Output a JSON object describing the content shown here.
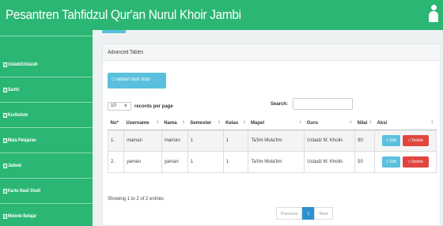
{
  "header": {
    "title": "Pesantren Tahfidzul Qur'an Nurul Khoir Jambi"
  },
  "sidebar": {
    "items": [
      {
        "label": "Ustadz/Ustazah"
      },
      {
        "label": "Santri"
      },
      {
        "label": "Kurikulum"
      },
      {
        "label": "Mata Pelajaran"
      },
      {
        "label": "Jadwal"
      },
      {
        "label": "Kartu Hasil Studi"
      },
      {
        "label": "Metode Belajar"
      }
    ]
  },
  "panel": {
    "heading": "Advanced Tables"
  },
  "toolbar": {
    "add_label": "□ Tambah Hasil Studi",
    "length_value": "10",
    "length_suffix": "records per page",
    "search_label": "Search:"
  },
  "table": {
    "columns": [
      "No*",
      "Username",
      "Nama",
      "Semester",
      "Kelas",
      "Mapel",
      "Guru",
      "Nilai",
      "Aksi"
    ],
    "rows": [
      {
        "no": "1.",
        "username": "maman",
        "nama": "maman",
        "semester": "1",
        "kelas": "1",
        "mapel": "Ta'lim Muta'lim",
        "guru": "Ustadz M. Kholis",
        "nilai": "90"
      },
      {
        "no": "2.",
        "username": "yaman",
        "nama": "yaman",
        "semester": "1",
        "kelas": "1",
        "mapel": "Ta'lim Muta'lim",
        "guru": "Ustadz M. Kholis",
        "nilai": "50"
      }
    ],
    "edit_label": "□ Edit",
    "delete_label": "□ Delete"
  },
  "footer": {
    "info": "Showing 1 to 2 of 2 entries",
    "prev": "Previous",
    "page": "1",
    "next": "Next"
  },
  "colors": {
    "brand": "#2bb673",
    "info": "#5bc0de",
    "danger": "#e0463f",
    "primary": "#2e90d1"
  },
  "icons": {
    "user": "user-icon",
    "menu": "table-icon"
  }
}
